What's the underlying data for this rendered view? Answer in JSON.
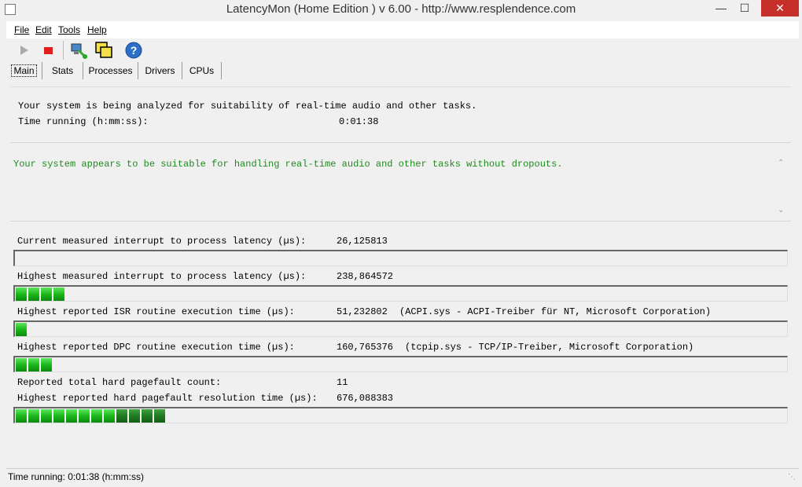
{
  "window": {
    "title": "LatencyMon  (Home Edition )  v 6.00 - http://www.resplendence.com",
    "minimize": "—",
    "maximize": "☐",
    "close": "✕"
  },
  "menu": [
    "File",
    "Edit",
    "Tools",
    "Help"
  ],
  "toolbar": {
    "buttons": [
      "play-icon",
      "stop-icon",
      "network-icon",
      "windows-icon",
      "help-icon"
    ]
  },
  "tabs": [
    "Main",
    "Stats",
    "Processes",
    "Drivers",
    "CPUs"
  ],
  "main": {
    "analyzing_text": "Your system is being analyzed for suitability of real-time audio and other tasks.",
    "time_label": "Time running (h:mm:ss):",
    "time_value": "0:01:38",
    "result_text": "Your system appears to be suitable for handling real-time audio and other tasks without dropouts.",
    "result_color": "#1f8b1f",
    "metrics": [
      {
        "label": "Current measured interrupt to process latency (µs):",
        "value": "26,125813",
        "detail": "",
        "bar_segments": 0
      },
      {
        "label": "Highest measured interrupt to process latency (µs):",
        "value": "238,864572",
        "detail": "",
        "bar_segments": 4
      },
      {
        "label": "Highest reported ISR routine execution time (µs):",
        "value": "51,232802",
        "detail": "(ACPI.sys - ACPI-Treiber für NT, Microsoft Corporation)",
        "bar_segments": 1
      },
      {
        "label": "Highest reported DPC routine execution time (µs):",
        "value": "160,765376",
        "detail": "(tcpip.sys - TCP/IP-Treiber, Microsoft Corporation)",
        "bar_segments": 3
      },
      {
        "label": "Reported total hard pagefault count:",
        "value": "11",
        "detail": ""
      },
      {
        "label": "Highest reported hard pagefault resolution time (µs):",
        "value": "676,088383",
        "detail": "",
        "bar_segments": 12
      }
    ]
  },
  "status": {
    "text": "Time running: 0:01:38  (h:mm:ss)"
  },
  "colors": {
    "bar_green": "#1bb81b",
    "close_red": "#c7302a"
  }
}
